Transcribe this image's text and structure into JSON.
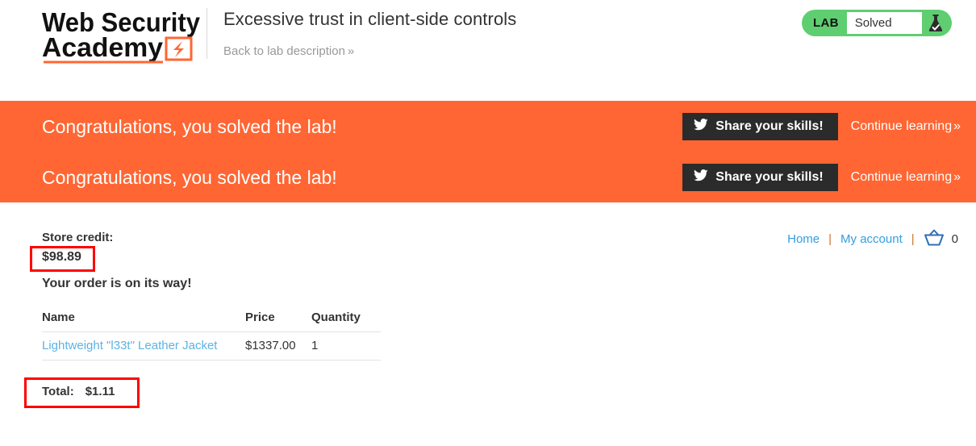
{
  "header": {
    "logo": {
      "line1": "Web Security",
      "line2": "Academy",
      "icon": "lightning-bolt-icon"
    },
    "lab_title": "Excessive trust in client-side controls",
    "back_link": {
      "label": "Back to lab description",
      "chevron": "»"
    },
    "lab_status": {
      "tag": "LAB",
      "value": "Solved",
      "icon": "flask-solved-icon",
      "background_color": "#5ece71"
    }
  },
  "banners": [
    {
      "message": "Congratulations, you solved the lab!",
      "share_button": {
        "label": "Share your skills!",
        "icon": "twitter-bird-icon"
      },
      "continue_link": {
        "label": "Continue learning",
        "chevron": "»"
      }
    },
    {
      "message": "Congratulations, you solved the lab!",
      "share_button": {
        "label": "Share your skills!",
        "icon": "twitter-bird-icon"
      },
      "continue_link": {
        "label": "Continue learning",
        "chevron": "»"
      }
    }
  ],
  "banner_color": "#ff6633",
  "shop": {
    "nav": {
      "home": "Home",
      "separator": "|",
      "my_account": "My account",
      "cart_icon": "shopping-basket-icon",
      "cart_count": "0"
    },
    "store_credit_label": "Store credit:",
    "store_credit_value": "$98.89",
    "order_heading": "Your order is on its way!",
    "table": {
      "columns": [
        "Name",
        "Price",
        "Quantity"
      ],
      "rows": [
        {
          "name": "Lightweight \"l33t\" Leather Jacket",
          "price": "$1337.00",
          "quantity": "1"
        }
      ]
    },
    "total_label": "Total:",
    "total_value": "$1.11"
  },
  "annotations": {
    "color": "#ff0000",
    "boxes": [
      "store-credit-highlight",
      "total-highlight"
    ]
  }
}
